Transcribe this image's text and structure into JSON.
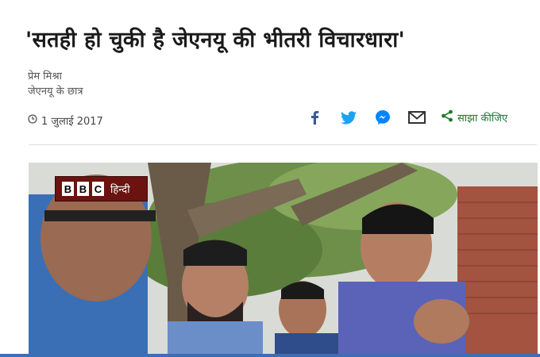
{
  "article": {
    "headline": "'सतही हो चुकी है जेएनयू की भीतरी विचारधारा'",
    "author_name": "प्रेम मिश्रा",
    "author_role": "जेएनयू के छात्र",
    "date": "1 जुलाई 2017"
  },
  "share": {
    "label": "साझा कीजिए",
    "icons": [
      "facebook-icon",
      "twitter-icon",
      "messenger-icon",
      "email-icon",
      "share-icon"
    ]
  },
  "photo": {
    "badge_letters": [
      "B",
      "B",
      "C"
    ],
    "badge_lang": "हिन्दी"
  },
  "colors": {
    "share_green": "#1d7a2c",
    "facebook": "#3b5998",
    "twitter": "#1da1f2",
    "messenger": "#0084ff",
    "email": "#333333",
    "badge_bg": "#6b1311"
  }
}
